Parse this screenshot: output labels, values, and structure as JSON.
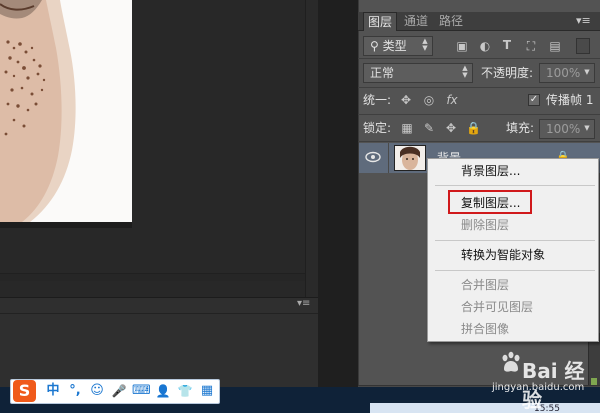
{
  "layers_panel": {
    "tabs": [
      {
        "label": "图层",
        "active": true
      },
      {
        "label": "通道",
        "active": false
      },
      {
        "label": "路径",
        "active": false
      }
    ],
    "filter_kind_value": "类型",
    "blend_mode_value": "正常",
    "opacity_label": "不透明度:",
    "opacity_value": "100%",
    "unify_label": "统一:",
    "propagate_frame_label": "传播帧 1",
    "propagate_frame_checked": true,
    "lock_label": "锁定:",
    "fill_label": "填充:",
    "fill_value": "100%",
    "layer": {
      "name": "背景",
      "visible": true,
      "locked": true
    }
  },
  "context_menu": {
    "items": [
      {
        "label": "背景图层...",
        "enabled": true
      },
      {
        "label": "复制图层...",
        "enabled": true,
        "highlighted": true
      },
      {
        "label": "删除图层",
        "enabled": false
      },
      {
        "label": "转换为智能对象",
        "enabled": true
      },
      {
        "label": "合并图层",
        "enabled": false
      },
      {
        "label": "合并可见图层",
        "enabled": false
      },
      {
        "label": "拼合图像",
        "enabled": false
      }
    ],
    "highlight_color": "#d0191b"
  },
  "ime_toolbar": {
    "logo": "S",
    "items": [
      "中",
      "°,",
      "☺",
      "🎤",
      "⌨",
      "👤",
      "👕",
      "▦"
    ]
  },
  "watermark": {
    "text": "Bai 经验",
    "url": "jingyan.baidu.com"
  },
  "taskbar": {
    "clock": "15:55"
  },
  "colors": {
    "panel_bg": "#535353",
    "layer_selected": "#5f6b7c",
    "menu_bg": "#f0f0f0",
    "ime_logo": "#f05a1a"
  }
}
